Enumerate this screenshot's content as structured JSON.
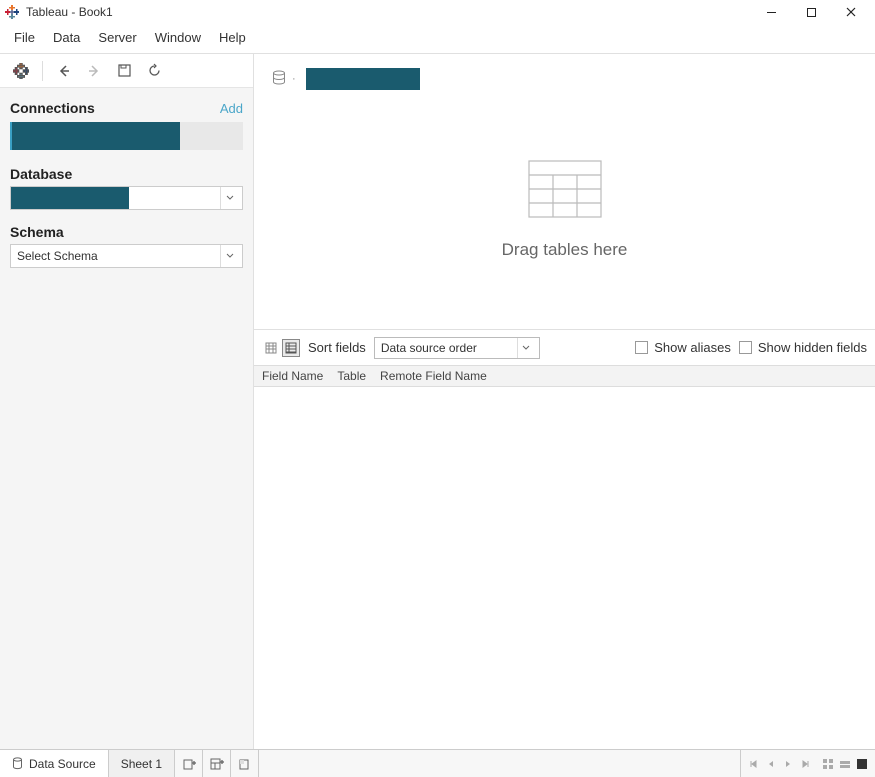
{
  "titlebar": {
    "title": "Tableau - Book1"
  },
  "menubar": {
    "items": [
      "File",
      "Data",
      "Server",
      "Window",
      "Help"
    ]
  },
  "sidebar": {
    "connections_label": "Connections",
    "add_label": "Add",
    "database_label": "Database",
    "schema_label": "Schema",
    "schema_placeholder": "Select Schema"
  },
  "canvas": {
    "drag_text": "Drag tables here"
  },
  "fields_toolbar": {
    "sort_label": "Sort fields",
    "sort_value": "Data source order",
    "show_aliases": "Show aliases",
    "show_hidden": "Show hidden fields"
  },
  "fields_header": {
    "col_field_name": "Field Name",
    "col_table": "Table",
    "col_remote": "Remote Field Name"
  },
  "tabs": {
    "data_source": "Data Source",
    "sheet1": "Sheet 1"
  }
}
